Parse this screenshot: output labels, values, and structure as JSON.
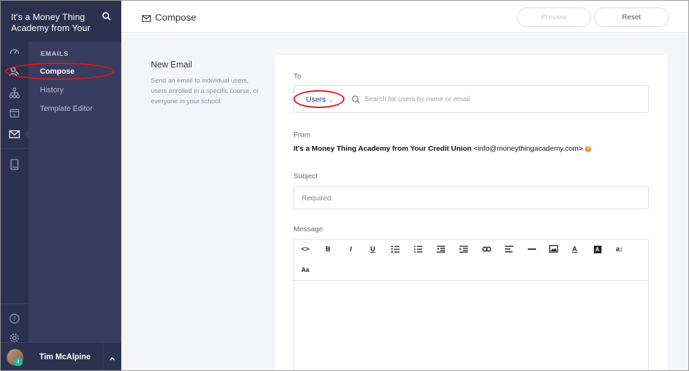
{
  "brand": {
    "title": "It's a Money Thing Academy from Your"
  },
  "subnav": {
    "section_title": "EMAILS",
    "items": [
      {
        "label": "Compose",
        "active": true
      },
      {
        "label": "History",
        "active": false
      },
      {
        "label": "Template Editor",
        "active": false
      }
    ]
  },
  "rail_icons": [
    "dashboard-icon",
    "users-icon",
    "sitemap-icon",
    "sales-icon",
    "email-icon",
    "book-icon",
    "help-icon",
    "settings-icon"
  ],
  "user": {
    "name": "Tim McAlpine",
    "avatar_badge": "t"
  },
  "header": {
    "title": "Compose",
    "preview_label": "Preview",
    "reset_label": "Reset"
  },
  "section": {
    "title": "New Email",
    "description": "Send an email to individual users, users enrolled in a specific course, or everyone in your school."
  },
  "form": {
    "to_label": "To",
    "to_type": "Users",
    "to_placeholder": "Search for users by name or email",
    "from_label": "From",
    "from_name": "It's a Money Thing Academy from Your Credit Union",
    "from_email": "<info@moneythingacademy.com>",
    "subject_label": "Subject",
    "subject_placeholder": "Required",
    "message_label": "Message"
  },
  "editor_toolbar": {
    "code": "<>",
    "bold": "B",
    "italic": "I",
    "underline": "U",
    "font_size": "Aa",
    "text_color": "A",
    "bg_color": "A",
    "line_height": "a↕"
  },
  "colors": {
    "sidebar_dark": "#2d3150",
    "sidebar_sub": "#383d5f",
    "accent": "#2c3c8e",
    "annotation": "#e3131b"
  }
}
